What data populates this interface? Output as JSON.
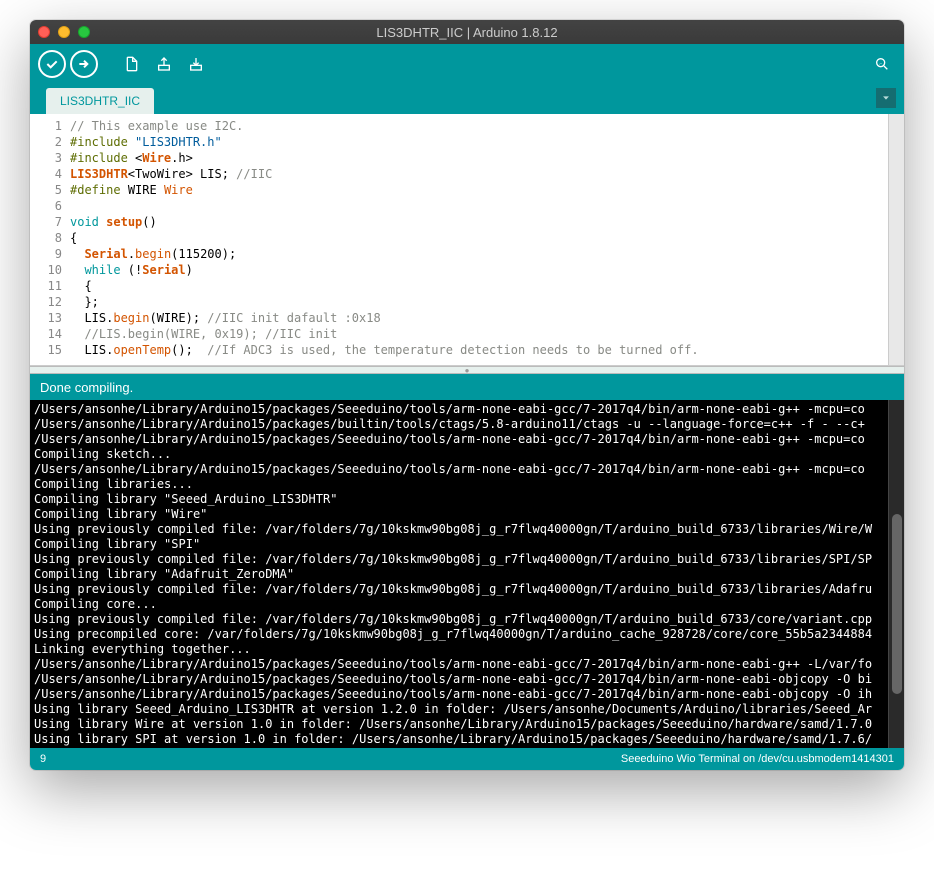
{
  "window": {
    "title": "LIS3DHTR_IIC | Arduino 1.8.12"
  },
  "tab": {
    "label": "LIS3DHTR_IIC"
  },
  "editor": {
    "lines": [
      {
        "n": 1,
        "segs": [
          [
            "c-comment",
            "// This example use I2C."
          ]
        ]
      },
      {
        "n": 2,
        "segs": [
          [
            "c-pre",
            "#include"
          ],
          [
            "",
            " "
          ],
          [
            "c-string",
            "\"LIS3DHTR.h\""
          ]
        ]
      },
      {
        "n": 3,
        "segs": [
          [
            "c-pre",
            "#include"
          ],
          [
            "",
            " <"
          ],
          [
            "c-type",
            "Wire"
          ],
          [
            "",
            ".h>"
          ]
        ]
      },
      {
        "n": 4,
        "segs": [
          [
            "c-type",
            "LIS3DHTR"
          ],
          [
            "",
            "<TwoWire> LIS; "
          ],
          [
            "c-comment",
            "//IIC"
          ]
        ]
      },
      {
        "n": 5,
        "segs": [
          [
            "c-pre",
            "#define"
          ],
          [
            "",
            " "
          ],
          [
            "",
            "WIRE "
          ],
          [
            "c-define",
            "Wire"
          ]
        ]
      },
      {
        "n": 6,
        "segs": []
      },
      {
        "n": 7,
        "segs": [
          [
            "c-keyword",
            "void"
          ],
          [
            "",
            " "
          ],
          [
            "c-type",
            "setup"
          ],
          [
            "",
            "()"
          ]
        ]
      },
      {
        "n": 8,
        "segs": [
          [
            "",
            "{"
          ]
        ]
      },
      {
        "n": 9,
        "segs": [
          [
            "",
            "  "
          ],
          [
            "c-type",
            "Serial"
          ],
          [
            "",
            "."
          ],
          [
            "c-method",
            "begin"
          ],
          [
            "",
            "(115200);"
          ]
        ]
      },
      {
        "n": 10,
        "segs": [
          [
            "",
            "  "
          ],
          [
            "c-keyword",
            "while"
          ],
          [
            "",
            " (!"
          ],
          [
            "c-type",
            "Serial"
          ],
          [
            "",
            ")"
          ]
        ]
      },
      {
        "n": 11,
        "segs": [
          [
            "",
            "  {"
          ]
        ]
      },
      {
        "n": 12,
        "segs": [
          [
            "",
            "  };"
          ]
        ]
      },
      {
        "n": 13,
        "segs": [
          [
            "",
            "  LIS."
          ],
          [
            "c-method",
            "begin"
          ],
          [
            "",
            "(WIRE); "
          ],
          [
            "c-comment",
            "//IIC init dafault :0x18"
          ]
        ]
      },
      {
        "n": 14,
        "segs": [
          [
            "",
            "  "
          ],
          [
            "c-comment",
            "//LIS.begin(WIRE, 0x19); //IIC init"
          ]
        ]
      },
      {
        "n": 15,
        "segs": [
          [
            "",
            "  LIS."
          ],
          [
            "c-method",
            "openTemp"
          ],
          [
            "",
            "();  "
          ],
          [
            "c-comment",
            "//If ADC3 is used, the temperature detection needs to be turned off."
          ]
        ]
      }
    ]
  },
  "status": {
    "text": "Done compiling."
  },
  "console": {
    "lines": [
      "/Users/ansonhe/Library/Arduino15/packages/Seeeduino/tools/arm-none-eabi-gcc/7-2017q4/bin/arm-none-eabi-g++ -mcpu=co",
      "/Users/ansonhe/Library/Arduino15/packages/builtin/tools/ctags/5.8-arduino11/ctags -u --language-force=c++ -f - --c+",
      "/Users/ansonhe/Library/Arduino15/packages/Seeeduino/tools/arm-none-eabi-gcc/7-2017q4/bin/arm-none-eabi-g++ -mcpu=co",
      "Compiling sketch...",
      "/Users/ansonhe/Library/Arduino15/packages/Seeeduino/tools/arm-none-eabi-gcc/7-2017q4/bin/arm-none-eabi-g++ -mcpu=co",
      "Compiling libraries...",
      "Compiling library \"Seeed_Arduino_LIS3DHTR\"",
      "Compiling library \"Wire\"",
      "Using previously compiled file: /var/folders/7g/10kskmw90bg08j_g_r7flwq40000gn/T/arduino_build_6733/libraries/Wire/W",
      "Compiling library \"SPI\"",
      "Using previously compiled file: /var/folders/7g/10kskmw90bg08j_g_r7flwq40000gn/T/arduino_build_6733/libraries/SPI/SP",
      "Compiling library \"Adafruit_ZeroDMA\"",
      "Using previously compiled file: /var/folders/7g/10kskmw90bg08j_g_r7flwq40000gn/T/arduino_build_6733/libraries/Adafru",
      "Compiling core...",
      "Using previously compiled file: /var/folders/7g/10kskmw90bg08j_g_r7flwq40000gn/T/arduino_build_6733/core/variant.cpp",
      "Using precompiled core: /var/folders/7g/10kskmw90bg08j_g_r7flwq40000gn/T/arduino_cache_928728/core/core_55b5a2344884",
      "Linking everything together...",
      "/Users/ansonhe/Library/Arduino15/packages/Seeeduino/tools/arm-none-eabi-gcc/7-2017q4/bin/arm-none-eabi-g++ -L/var/fo",
      "/Users/ansonhe/Library/Arduino15/packages/Seeeduino/tools/arm-none-eabi-gcc/7-2017q4/bin/arm-none-eabi-objcopy -O bi",
      "/Users/ansonhe/Library/Arduino15/packages/Seeeduino/tools/arm-none-eabi-gcc/7-2017q4/bin/arm-none-eabi-objcopy -O ih",
      "Using library Seeed_Arduino_LIS3DHTR at version 1.2.0 in folder: /Users/ansonhe/Documents/Arduino/libraries/Seeed_Ar",
      "Using library Wire at version 1.0 in folder: /Users/ansonhe/Library/Arduino15/packages/Seeeduino/hardware/samd/1.7.0",
      "Using library SPI at version 1.0 in folder: /Users/ansonhe/Library/Arduino15/packages/Seeeduino/hardware/samd/1.7.6/"
    ]
  },
  "footer": {
    "line": "9",
    "board": "Seeeduino Wio Terminal on /dev/cu.usbmodem1414301"
  }
}
